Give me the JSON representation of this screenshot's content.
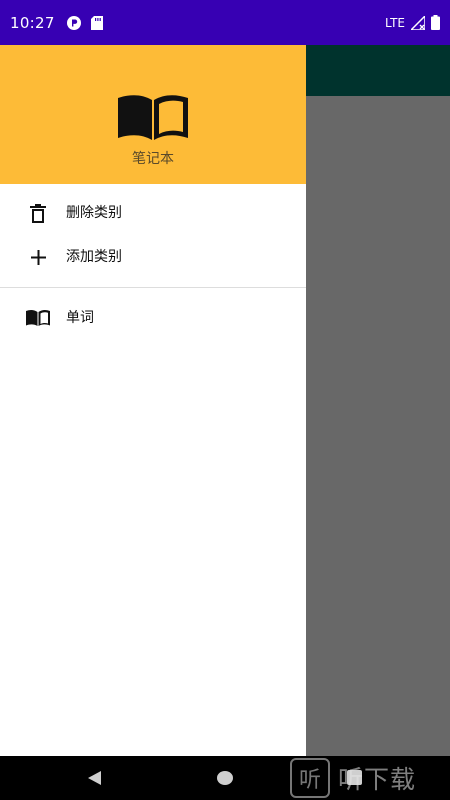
{
  "status_bar": {
    "time": "10:27",
    "network": "LTE",
    "icons": [
      "notification-p-icon",
      "sd-card-icon",
      "signal-icon",
      "battery-icon"
    ]
  },
  "drawer": {
    "header": {
      "title": "笔记本",
      "icon": "open-book-icon",
      "background": "#fdbb37"
    },
    "actions": [
      {
        "label": "删除类别",
        "icon": "trash-icon"
      },
      {
        "label": "添加类别",
        "icon": "plus-icon"
      }
    ],
    "categories": [
      {
        "label": "单词",
        "icon": "book-icon"
      }
    ]
  },
  "navigation": {
    "icons": [
      "back-icon",
      "home-icon",
      "recents-icon"
    ]
  },
  "watermark": {
    "logo_glyph": "听",
    "text": "听下载"
  },
  "colors": {
    "status_bar": "#3700b3",
    "toolbar": "#00332d",
    "scrim": "#686868"
  }
}
